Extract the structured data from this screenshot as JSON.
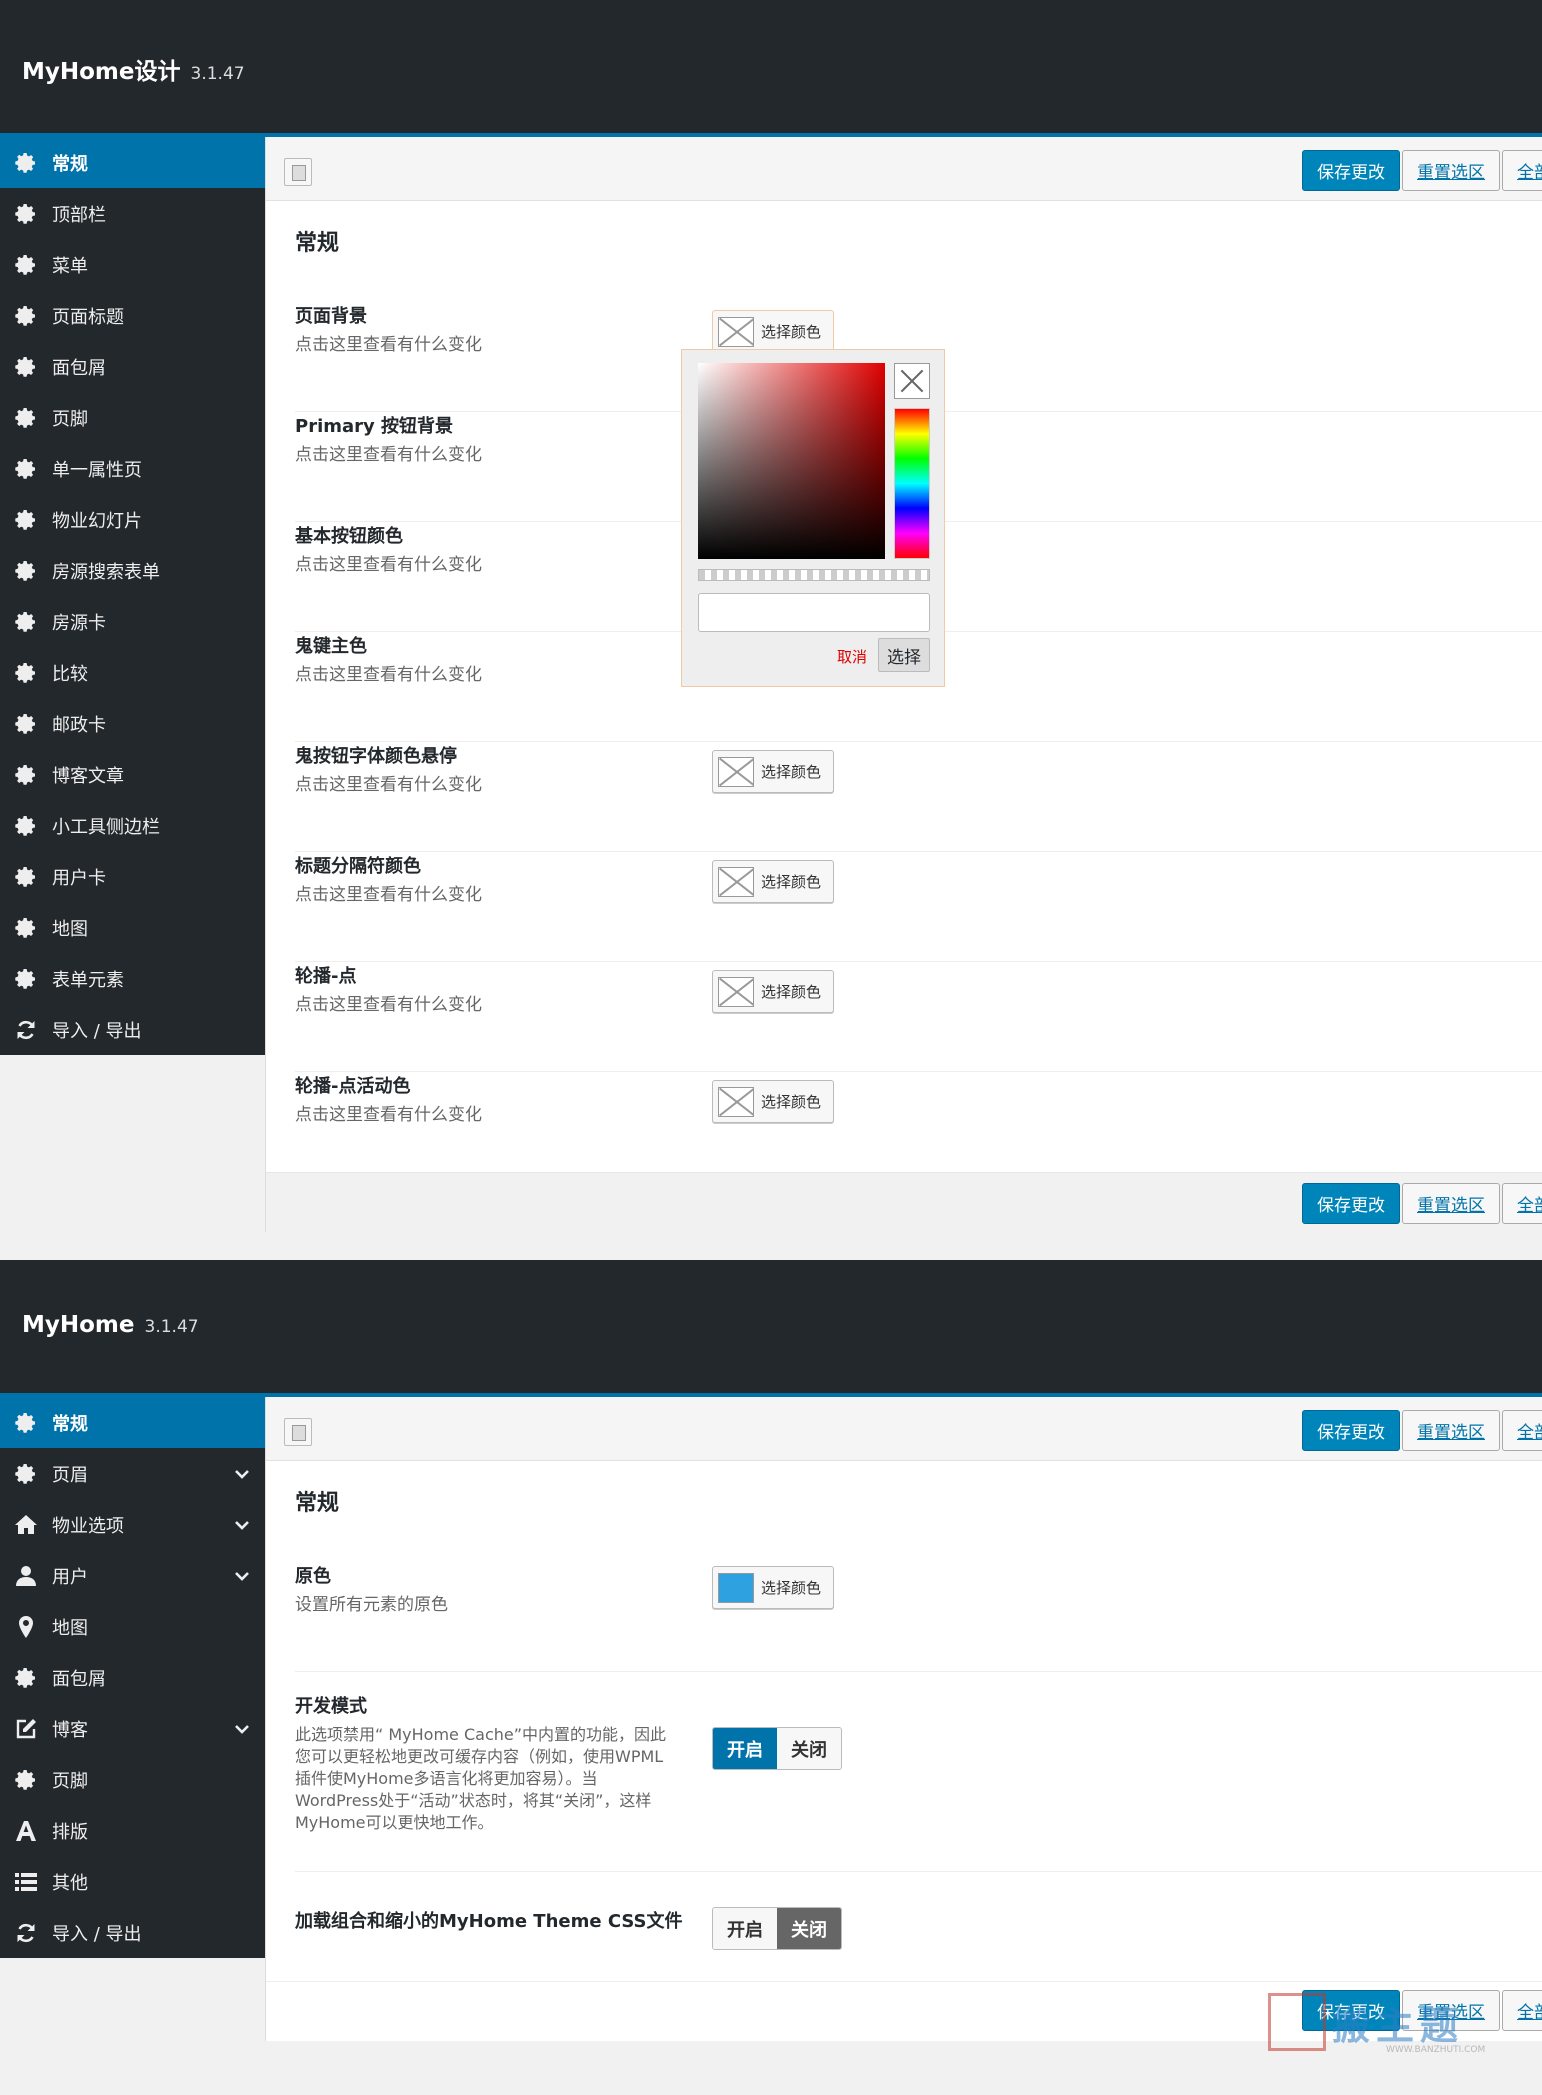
{
  "panel1": {
    "header": {
      "title": "MyHome设计",
      "version": "3.1.47"
    },
    "sidebar": [
      {
        "label": "常规",
        "icon": "gear-icon"
      },
      {
        "label": "顶部栏",
        "icon": "gear-icon"
      },
      {
        "label": "菜单",
        "icon": "gear-icon"
      },
      {
        "label": "页面标题",
        "icon": "gear-icon"
      },
      {
        "label": "面包屑",
        "icon": "gear-icon"
      },
      {
        "label": "页脚",
        "icon": "gear-icon"
      },
      {
        "label": "单一属性页",
        "icon": "gear-icon"
      },
      {
        "label": "物业幻灯片",
        "icon": "gear-icon"
      },
      {
        "label": "房源搜索表单",
        "icon": "gear-icon"
      },
      {
        "label": "房源卡",
        "icon": "gear-icon"
      },
      {
        "label": "比较",
        "icon": "gear-icon"
      },
      {
        "label": "邮政卡",
        "icon": "gear-icon"
      },
      {
        "label": "博客文章",
        "icon": "gear-icon"
      },
      {
        "label": "小工具侧边栏",
        "icon": "gear-icon"
      },
      {
        "label": "用户卡",
        "icon": "gear-icon"
      },
      {
        "label": "地图",
        "icon": "gear-icon"
      },
      {
        "label": "表单元素",
        "icon": "gear-icon"
      },
      {
        "label": "导入 / 导出",
        "icon": "refresh-icon"
      }
    ],
    "toolbar": {
      "save": "保存更改",
      "reset_section": "重置选区",
      "reset_all": "全部"
    },
    "section_title": "常规",
    "color_button_label": "选择颜色",
    "rows": [
      {
        "label": "页面背景",
        "desc": "点击这里查看有什么变化"
      },
      {
        "label": "Primary 按钮背景",
        "desc": "点击这里查看有什么变化"
      },
      {
        "label": "基本按钮颜色",
        "desc": "点击这里查看有什么变化"
      },
      {
        "label": "鬼键主色",
        "desc": "点击这里查看有什么变化"
      },
      {
        "label": "鬼按钮字体颜色悬停",
        "desc": "点击这里查看有什么变化"
      },
      {
        "label": "标题分隔符颜色",
        "desc": "点击这里查看有什么变化"
      },
      {
        "label": "轮播-点",
        "desc": "点击这里查看有什么变化"
      },
      {
        "label": "轮播-点活动色",
        "desc": "点击这里查看有什么变化"
      }
    ],
    "picker": {
      "cancel": "取消",
      "choose": "选择"
    }
  },
  "panel2": {
    "header": {
      "title": "MyHome",
      "version": "3.1.47"
    },
    "sidebar": [
      {
        "label": "常规",
        "icon": "gear-icon",
        "expand": false
      },
      {
        "label": "页眉",
        "icon": "gear-icon",
        "expand": true
      },
      {
        "label": "物业选项",
        "icon": "home-icon",
        "expand": true
      },
      {
        "label": "用户",
        "icon": "user-icon",
        "expand": true
      },
      {
        "label": "地图",
        "icon": "map-pin-icon",
        "expand": false
      },
      {
        "label": "面包屑",
        "icon": "gear-icon",
        "expand": false
      },
      {
        "label": "博客",
        "icon": "edit-icon",
        "expand": true
      },
      {
        "label": "页脚",
        "icon": "gear-icon",
        "expand": false
      },
      {
        "label": "排版",
        "icon": "font-icon",
        "expand": false
      },
      {
        "label": "其他",
        "icon": "list-icon",
        "expand": false
      },
      {
        "label": "导入 / 导出",
        "icon": "refresh-icon",
        "expand": false
      }
    ],
    "toolbar": {
      "save": "保存更改",
      "reset_section": "重置选区",
      "reset_all": "全部"
    },
    "section_title": "常规",
    "primary_color": {
      "label": "原色",
      "desc": "设置所有元素的原色",
      "button": "选择颜色",
      "color": "#2ea2e0"
    },
    "dev_mode": {
      "label": "开发模式",
      "desc": "此选项禁用“ MyHome Cache”中内置的功能，因此您可以更轻松地更改可缓存内容（例如，使用WPML插件使MyHome多语言化将更加容易）。当WordPress处于“活动”状态时，将其“关闭”，这样MyHome可以更快地工作。",
      "on": "开启",
      "off": "关闭",
      "value": "on"
    },
    "css_files": {
      "label": "加载组合和缩小的MyHome Theme CSS文件",
      "on": "开启",
      "off": "关闭",
      "value": "off"
    }
  },
  "colors": {
    "accent": "#0073aa",
    "sidebar_bg": "#23282d",
    "header_bg": "#23282d"
  }
}
